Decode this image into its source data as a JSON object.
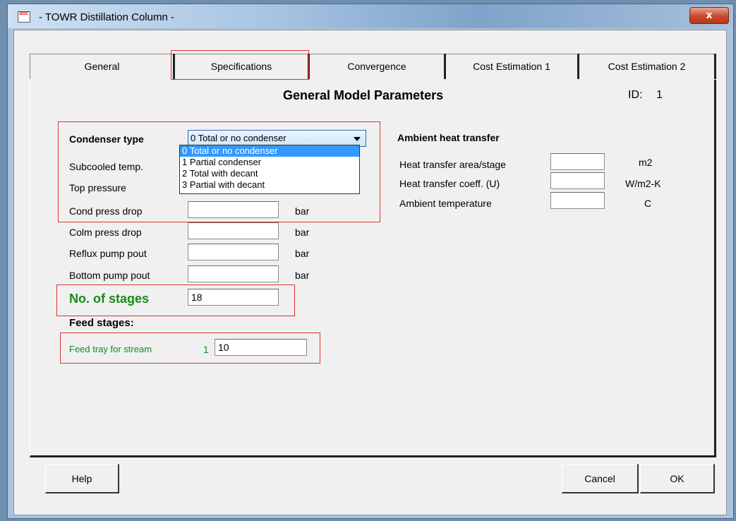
{
  "window": {
    "title": "- TOWR Distillation Column -",
    "app_icon_text": "DOC",
    "close_label": "x"
  },
  "tabs": [
    {
      "label": "General"
    },
    {
      "label": "Specifications"
    },
    {
      "label": "Convergence"
    },
    {
      "label": "Cost Estimation 1"
    },
    {
      "label": "Cost Estimation 2"
    }
  ],
  "header": {
    "title": "General Model Parameters",
    "id_label": "ID:",
    "id_value": "1"
  },
  "condenser": {
    "label": "Condenser type",
    "selected": "0 Total or no condenser",
    "options": [
      "0 Total or no condenser",
      "1 Partial condenser",
      "2 Total with decant",
      "3 Partial with decant"
    ]
  },
  "left_fields": {
    "subcooled_temp": {
      "label": "Subcooled temp.",
      "value": ""
    },
    "top_pressure": {
      "label": "Top pressure",
      "value": ""
    },
    "cond_press_drop": {
      "label": "Cond press drop",
      "value": "",
      "unit": "bar"
    },
    "colm_press_drop": {
      "label": "Colm press drop",
      "value": "",
      "unit": "bar"
    },
    "reflux_pump_pout": {
      "label": "Reflux pump pout",
      "value": "",
      "unit": "bar"
    },
    "bottom_pump_pout": {
      "label": "Bottom pump pout",
      "value": "",
      "unit": "bar"
    }
  },
  "stages": {
    "label": "No. of stages",
    "value": "18"
  },
  "feed": {
    "section_label": "Feed stages:",
    "row_label": "Feed tray for stream",
    "stream_number": "1",
    "value": "10"
  },
  "ambient": {
    "title": "Ambient heat transfer",
    "area": {
      "label": "Heat transfer area/stage",
      "value": "",
      "unit": "m2"
    },
    "coeff": {
      "label": "Heat transfer coeff. (U)",
      "value": "",
      "unit": "W/m2-K"
    },
    "temp": {
      "label": "Ambient temperature",
      "value": "",
      "unit": "C"
    }
  },
  "buttons": {
    "help": "Help",
    "cancel": "Cancel",
    "ok": "OK"
  },
  "colors": {
    "highlight_box": "#dd3333",
    "green_text": "#1a8a1a",
    "selection": "#3399ff"
  }
}
